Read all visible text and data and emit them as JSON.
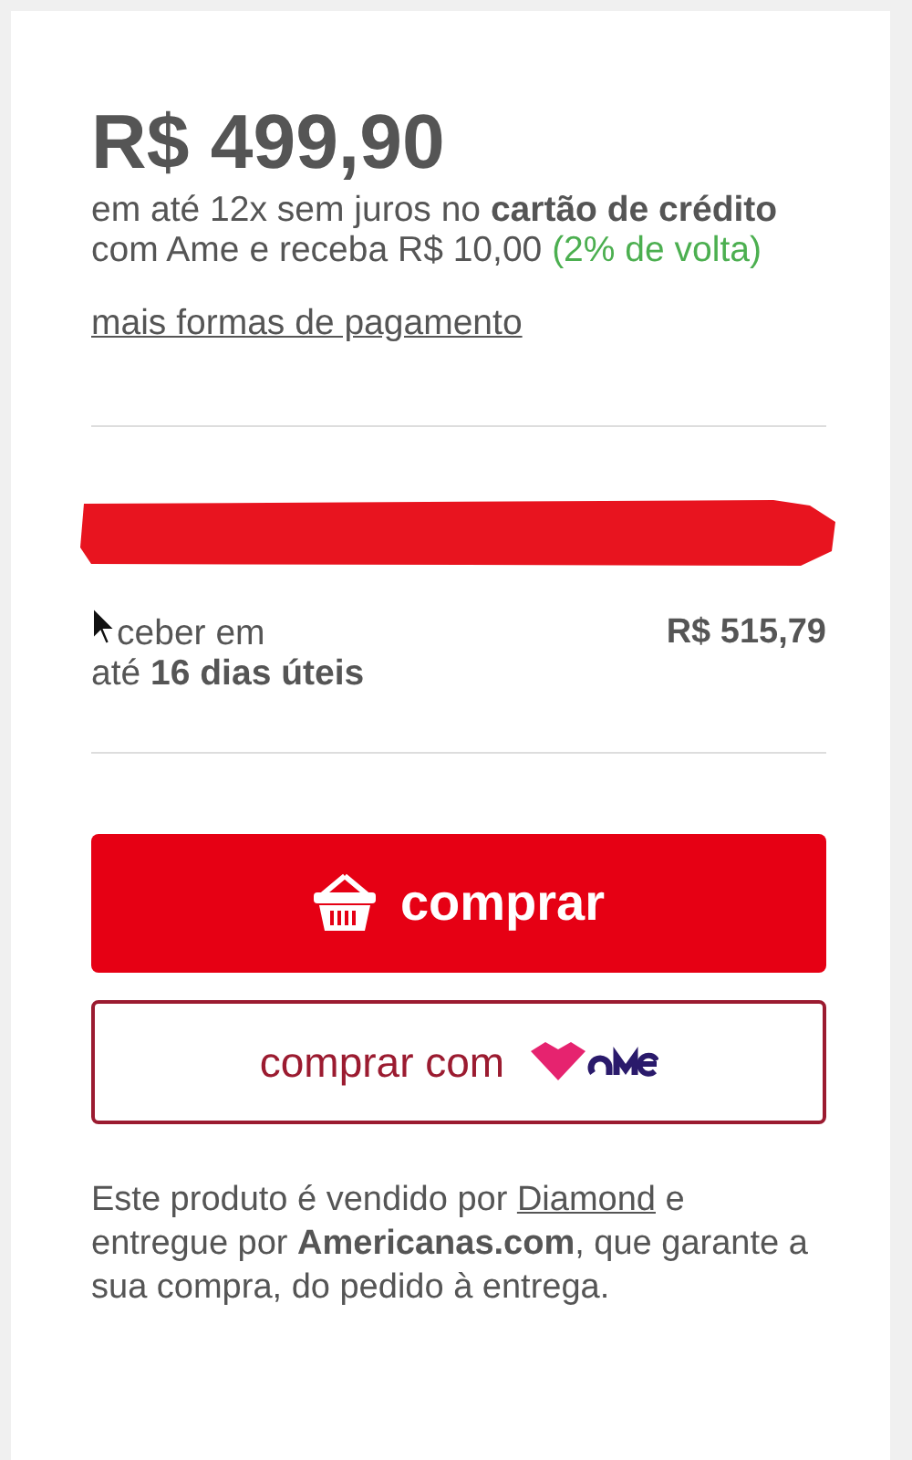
{
  "price": "R$ 499,90",
  "installments": "em até 12x sem juros no **cartão de crédito**",
  "cashback": {
    "text": "com Ame e receba R$ 10,00",
    "highlight": "(2% de volta)"
  },
  "payment_link": "mais formas de pagamento",
  "delivery": {
    "label": "ceber em",
    "time": "até **16 dias úteis**",
    "price": "R$ 515,79"
  },
  "buy_button": "comprar",
  "ame_button": "comprar com",
  "seller_note": {
    "before": "Este produto é vendido por",
    "seller": "Diamond",
    "after": "e entregue por **Americanas.com**, que garante a sua compra, do pedido à entrega."
  }
}
